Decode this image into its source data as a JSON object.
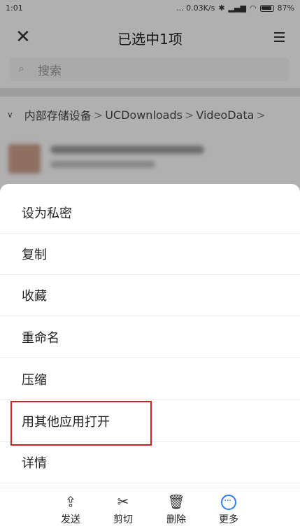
{
  "status_bar": {
    "time": "1:01",
    "network_speed": "... 0.03K/s",
    "battery": "87%"
  },
  "header": {
    "title": "已选中1项"
  },
  "search": {
    "placeholder": "搜索"
  },
  "breadcrumb": {
    "root": "内部存储设备",
    "items": [
      "UCDownloads",
      "VideoData"
    ]
  },
  "menu": {
    "items": [
      {
        "label": "设为私密"
      },
      {
        "label": "复制"
      },
      {
        "label": "收藏"
      },
      {
        "label": "重命名"
      },
      {
        "label": "压缩"
      },
      {
        "label": "用其他应用打开"
      },
      {
        "label": "详情"
      }
    ],
    "highlighted_index": 5
  },
  "toolbar": {
    "send": "发送",
    "cut": "剪切",
    "delete": "删除",
    "more": "更多"
  },
  "colors": {
    "accent_blue": "#2f7cf6",
    "highlight_red": "#d62020"
  }
}
